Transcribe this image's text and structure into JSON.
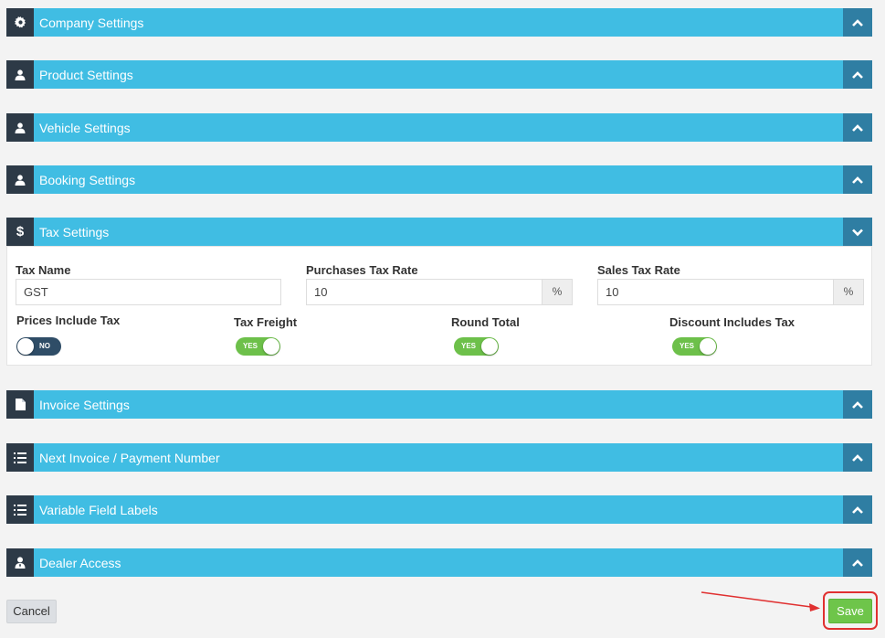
{
  "panels": [
    {
      "title": "Company Settings",
      "icon": "gear-icon"
    },
    {
      "title": "Product Settings",
      "icon": "user-icon"
    },
    {
      "title": "Vehicle Settings",
      "icon": "user-icon"
    },
    {
      "title": "Booking Settings",
      "icon": "user-icon"
    },
    {
      "title": "Tax Settings",
      "icon": "dollar-icon"
    },
    {
      "title": "Invoice Settings",
      "icon": "file-icon"
    },
    {
      "title": "Next Invoice / Payment Number",
      "icon": "list-icon"
    },
    {
      "title": "Variable Field Labels",
      "icon": "list-icon"
    },
    {
      "title": "Dealer Access",
      "icon": "user-tie-icon"
    }
  ],
  "tax": {
    "tax_name_label": "Tax Name",
    "tax_name_value": "GST",
    "purchases_label": "Purchases Tax Rate",
    "purchases_value": "10",
    "purchases_unit": "%",
    "sales_label": "Sales Tax Rate",
    "sales_value": "10",
    "sales_unit": "%",
    "prices_include_label": "Prices Include Tax",
    "prices_include_state": "NO",
    "tax_freight_label": "Tax Freight",
    "tax_freight_state": "YES",
    "round_total_label": "Round Total",
    "round_total_state": "YES",
    "discount_label": "Discount Includes Tax",
    "discount_state": "YES"
  },
  "actions": {
    "cancel_label": "Cancel",
    "save_label": "Save"
  },
  "colors": {
    "panel_bar": "#40bde3",
    "icon_box": "#2d3a47",
    "chevron_box": "#2f7ea3",
    "toggle_on": "#6dc04a",
    "toggle_off": "#2f4d67",
    "save": "#6ec54a",
    "highlight": "#e03030"
  }
}
